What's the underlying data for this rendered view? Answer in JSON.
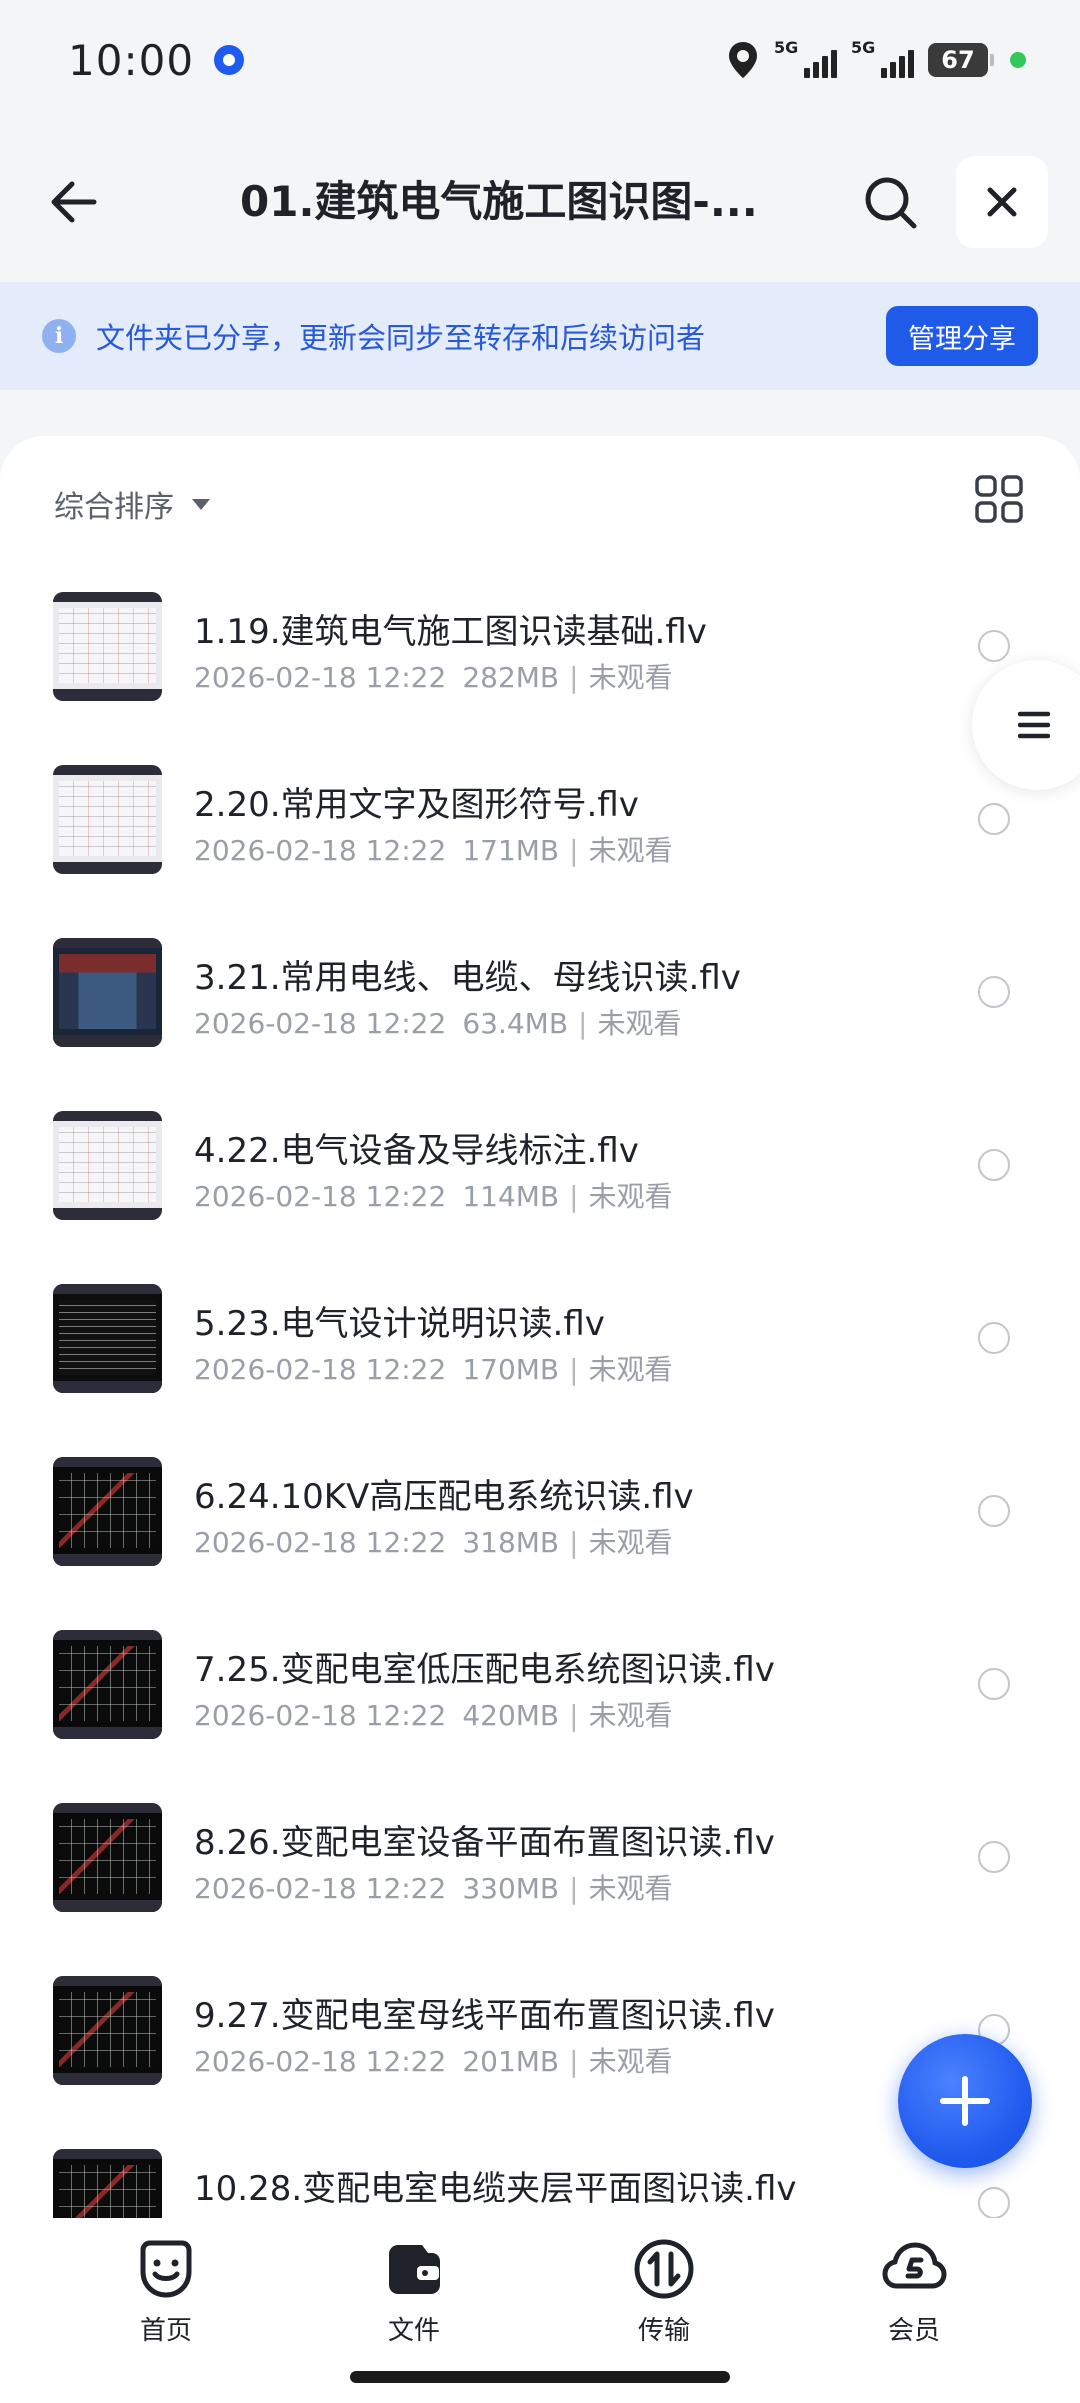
{
  "status_bar": {
    "time": "10:00",
    "network_1": "5G",
    "network_2": "5G",
    "battery": "67"
  },
  "header": {
    "title": "01.建筑电气施工图识图-...",
    "icons": [
      "back-arrow-icon",
      "search-icon",
      "close-icon"
    ]
  },
  "share_banner": {
    "message": "文件夹已分享，更新会同步至转存和后续访问者",
    "button_label": "管理分享",
    "accent_color": "#1f5ae8"
  },
  "sort_bar": {
    "label": "综合排序"
  },
  "files": [
    {
      "name": "1.19.建筑电气施工图识读基础.flv",
      "date": "2026-02-18 12:22",
      "size": "282MB",
      "status": "未观看",
      "thumb": "light"
    },
    {
      "name": "2.20.常用文字及图形符号.flv",
      "date": "2026-02-18 12:22",
      "size": "171MB",
      "status": "未观看",
      "thumb": "light"
    },
    {
      "name": "3.21.常用电线、电缆、母线识读.flv",
      "date": "2026-02-18 12:22",
      "size": "63.4MB",
      "status": "未观看",
      "thumb": "blueprint"
    },
    {
      "name": "4.22.电气设备及导线标注.flv",
      "date": "2026-02-18 12:22",
      "size": "114MB",
      "status": "未观看",
      "thumb": "light"
    },
    {
      "name": "5.23.电气设计说明识读.flv",
      "date": "2026-02-18 12:22",
      "size": "170MB",
      "status": "未观看",
      "thumb": "dark"
    },
    {
      "name": "6.24.10KV高压配电系统识读.flv",
      "date": "2026-02-18 12:22",
      "size": "318MB",
      "status": "未观看",
      "thumb": "cad"
    },
    {
      "name": "7.25.变配电室低压配电系统图识读.flv",
      "date": "2026-02-18 12:22",
      "size": "420MB",
      "status": "未观看",
      "thumb": "cad"
    },
    {
      "name": "8.26.变配电室设备平面布置图识读.flv",
      "date": "2026-02-18 12:22",
      "size": "330MB",
      "status": "未观看",
      "thumb": "cad"
    },
    {
      "name": "9.27.变配电室母线平面布置图识读.flv",
      "date": "2026-02-18 12:22",
      "size": "201MB",
      "status": "未观看",
      "thumb": "cad"
    },
    {
      "name": "10.28.变配电室电缆夹层平面图识读.flv",
      "date": "",
      "size": "",
      "status": "",
      "thumb": "cad"
    }
  ],
  "bottom_nav": [
    {
      "label": "首页",
      "icon": "smiley-home-icon"
    },
    {
      "label": "文件",
      "icon": "wallet-file-icon"
    },
    {
      "label": "传输",
      "icon": "transfer-icon"
    },
    {
      "label": "会员",
      "icon": "cloud-vip-icon"
    }
  ]
}
